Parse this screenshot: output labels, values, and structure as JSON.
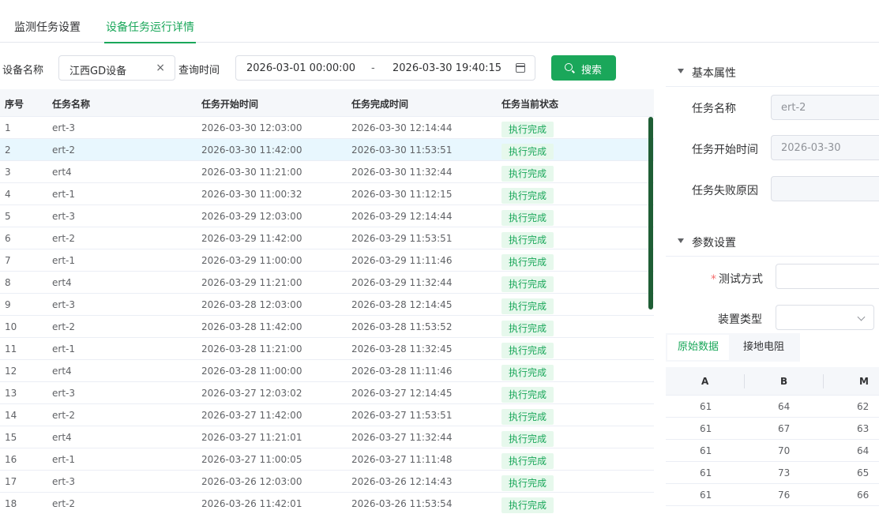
{
  "tabs": [
    {
      "label": "监测任务设置",
      "active": false
    },
    {
      "label": "设备任务运行详情",
      "active": true
    }
  ],
  "filter": {
    "device_label": "设备名称",
    "device_value": "江西GD设备",
    "clear_icon": "×",
    "time_label": "查询时间",
    "start": "2026-03-01 00:00:00",
    "separator": "-",
    "end": "2026-03-30 19:40:15",
    "search_label": "搜索"
  },
  "table": {
    "headers": [
      "序号",
      "任务名称",
      "任务开始时间",
      "任务完成时间",
      "任务当前状态"
    ],
    "highlight_row": 1,
    "rows": [
      [
        "1",
        "ert-3",
        "2026-03-30 12:03:00",
        "2026-03-30 12:14:44",
        "执行完成"
      ],
      [
        "2",
        "ert-2",
        "2026-03-30 11:42:00",
        "2026-03-30 11:53:51",
        "执行完成"
      ],
      [
        "3",
        "ert4",
        "2026-03-30 11:21:00",
        "2026-03-30 11:32:44",
        "执行完成"
      ],
      [
        "4",
        "ert-1",
        "2026-03-30 11:00:32",
        "2026-03-30 11:12:15",
        "执行完成"
      ],
      [
        "5",
        "ert-3",
        "2026-03-29 12:03:00",
        "2026-03-29 12:14:44",
        "执行完成"
      ],
      [
        "6",
        "ert-2",
        "2026-03-29 11:42:00",
        "2026-03-29 11:53:51",
        "执行完成"
      ],
      [
        "7",
        "ert-1",
        "2026-03-29 11:00:00",
        "2026-03-29 11:11:46",
        "执行完成"
      ],
      [
        "8",
        "ert4",
        "2026-03-29 11:21:00",
        "2026-03-29 11:32:44",
        "执行完成"
      ],
      [
        "9",
        "ert-3",
        "2026-03-28 12:03:00",
        "2026-03-28 12:14:45",
        "执行完成"
      ],
      [
        "10",
        "ert-2",
        "2026-03-28 11:42:00",
        "2026-03-28 11:53:52",
        "执行完成"
      ],
      [
        "11",
        "ert-1",
        "2026-03-28 11:21:00",
        "2026-03-28 11:32:45",
        "执行完成"
      ],
      [
        "12",
        "ert4",
        "2026-03-28 11:00:00",
        "2026-03-28 11:11:46",
        "执行完成"
      ],
      [
        "13",
        "ert-3",
        "2026-03-27 12:03:02",
        "2026-03-27 12:14:45",
        "执行完成"
      ],
      [
        "14",
        "ert-2",
        "2026-03-27 11:42:00",
        "2026-03-27 11:53:51",
        "执行完成"
      ],
      [
        "15",
        "ert4",
        "2026-03-27 11:21:01",
        "2026-03-27 11:32:44",
        "执行完成"
      ],
      [
        "16",
        "ert-1",
        "2026-03-27 11:00:05",
        "2026-03-27 11:11:48",
        "执行完成"
      ],
      [
        "17",
        "ert-3",
        "2026-03-26 12:03:00",
        "2026-03-26 12:14:43",
        "执行完成"
      ],
      [
        "18",
        "ert-2",
        "2026-03-26 11:42:01",
        "2026-03-26 11:53:54",
        "执行完成"
      ]
    ]
  },
  "panel": {
    "basic": {
      "title": "基本属性",
      "task_name_label": "任务名称",
      "task_name_value": "ert-2",
      "start_label": "任务开始时间",
      "start_value": "2026-03-30",
      "fail_label": "任务失败原因",
      "fail_value": ""
    },
    "params": {
      "title": "参数设置",
      "required_mark": "*",
      "test_mode_label": "测试方式",
      "device_type_label": "装置类型"
    },
    "data_tabs": [
      {
        "label": "原始数据",
        "active": true
      },
      {
        "label": "接地电阻",
        "active": false
      }
    ],
    "data_headers": [
      "A",
      "B",
      "M"
    ],
    "data_rows": [
      [
        "61",
        "64",
        "62"
      ],
      [
        "61",
        "67",
        "63"
      ],
      [
        "61",
        "70",
        "64"
      ],
      [
        "61",
        "73",
        "65"
      ],
      [
        "61",
        "76",
        "66"
      ]
    ]
  },
  "colors": {
    "accent": "#1aa75a",
    "tag_bg": "#e6f8ec",
    "row_highlight": "#e8f7fe",
    "scrollbar": "#1f5e35"
  }
}
